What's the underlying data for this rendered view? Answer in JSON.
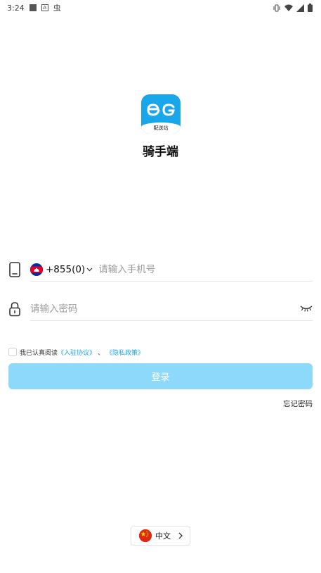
{
  "status_bar": {
    "time": "3:24",
    "bug_glyph": "虫",
    "icons": [
      "square-icon",
      "a-icon",
      "bug-icon",
      "vibrate-icon",
      "wifi-icon",
      "signal-icon",
      "battery-icon"
    ]
  },
  "app": {
    "logo_text": "配送站",
    "name": "骑手端",
    "brand_color": "#1aa7ea"
  },
  "login": {
    "country_code": "+855(0)",
    "phone_placeholder": "请输入手机号",
    "password_placeholder": "请输入密码",
    "agreement_prefix": "我已认真阅读",
    "agreement_link1": "《入驻协议》",
    "agreement_separator": "、",
    "agreement_link2": "《隐私政策》",
    "login_button": "登录",
    "login_button_color": "#8dd9fb",
    "forgot_password": "忘记密码"
  },
  "language": {
    "current": "中文"
  }
}
